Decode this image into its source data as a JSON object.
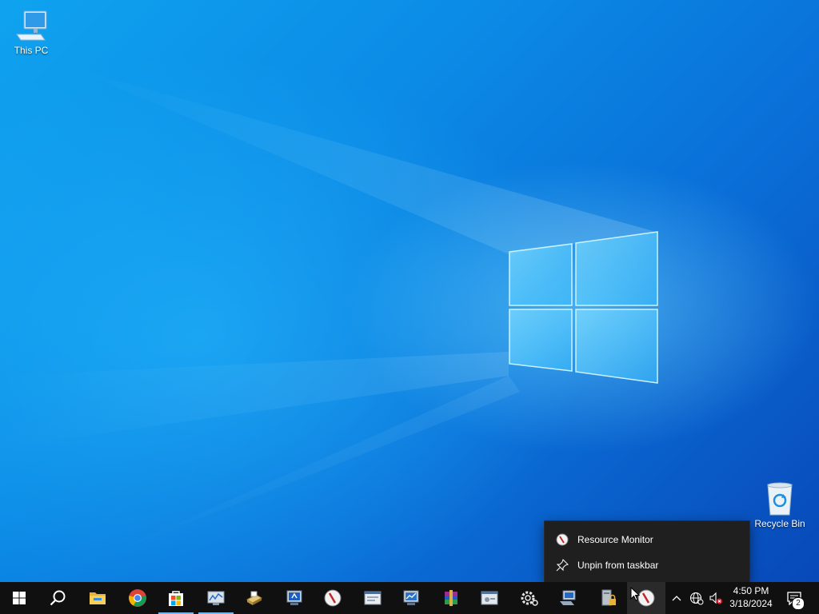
{
  "desktop": {
    "icons": [
      {
        "label": "This PC",
        "icon": "monitor-icon"
      },
      {
        "label": "Recycle Bin",
        "icon": "recycle-bin-icon"
      }
    ]
  },
  "context_menu": {
    "items": [
      {
        "label": "Resource Monitor",
        "icon": "resource-monitor-icon"
      },
      {
        "label": "Unpin from taskbar",
        "icon": "unpin-icon"
      }
    ]
  },
  "taskbar": {
    "buttons": [
      {
        "name": "start-button",
        "icon": "windows-logo-icon"
      },
      {
        "name": "search-button",
        "icon": "search-icon"
      },
      {
        "name": "file-explorer",
        "icon": "folder-icon"
      },
      {
        "name": "chrome",
        "icon": "chrome-icon"
      },
      {
        "name": "microsoft-store",
        "icon": "store-icon",
        "active": true
      },
      {
        "name": "performance-monitor",
        "icon": "performance-monitor-icon",
        "active": true
      },
      {
        "name": "scanner-app",
        "icon": "scanner-icon"
      },
      {
        "name": "remote-desktop",
        "icon": "remote-desktop-icon"
      },
      {
        "name": "resource-monitor-1",
        "icon": "resource-monitor-icon"
      },
      {
        "name": "task-scheduler",
        "icon": "task-window-icon"
      },
      {
        "name": "system-monitor",
        "icon": "system-monitor-icon"
      },
      {
        "name": "winrar",
        "icon": "winrar-icon"
      },
      {
        "name": "services",
        "icon": "services-window-icon"
      },
      {
        "name": "settings",
        "icon": "gear-icon"
      },
      {
        "name": "network",
        "icon": "network-computer-icon"
      },
      {
        "name": "security",
        "icon": "server-lock-icon"
      },
      {
        "name": "resource-monitor-2",
        "icon": "resource-monitor-icon",
        "hover": true
      }
    ],
    "tray": {
      "icons": [
        "chevron-up-icon",
        "network-globe-icon",
        "speaker-muted-icon"
      ],
      "time": "4:50 PM",
      "date": "3/18/2024",
      "notification_count": "2"
    }
  },
  "colors": {
    "taskbar": "#101010",
    "menu": "#1f1f1f",
    "active_indicator": "#76b9ed",
    "desktop_accent": "#0a63d4"
  }
}
